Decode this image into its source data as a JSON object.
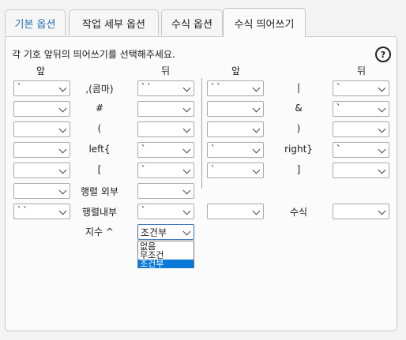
{
  "tabs": [
    {
      "label": "기본 옵션"
    },
    {
      "label": "작업 세부 옵션"
    },
    {
      "label": "수식 옵션"
    },
    {
      "label": "수식 띄어쓰기"
    }
  ],
  "instruction": "각 기호 앞뒤의 띄어쓰기를 선택해주세요.",
  "help_icon": "?",
  "headers": {
    "left_before": "앞",
    "left_after": "뒤",
    "right_before": "앞",
    "right_after": "뒤"
  },
  "rows": [
    {
      "label": ",(콤마)",
      "before": "`",
      "after": "``",
      "r_label": "|",
      "r_before": "``",
      "r_after": "`"
    },
    {
      "label": "#",
      "before": "",
      "after": "",
      "r_label": "&",
      "r_before": "",
      "r_after": "`"
    },
    {
      "label": "(",
      "before": "",
      "after": "",
      "r_label": ")",
      "r_before": "",
      "r_after": ""
    },
    {
      "label": "left{",
      "before": "",
      "after": "`",
      "r_label": "right}",
      "r_before": "`",
      "r_after": "`"
    },
    {
      "label": "[",
      "before": "",
      "after": "`",
      "r_label": "]",
      "r_before": "`",
      "r_after": ""
    },
    {
      "label": "행렬 외부",
      "before": "",
      "after": ""
    },
    {
      "label": "행렬내부",
      "before": "``",
      "after": "`",
      "r_label": "수식",
      "r_before": "",
      "r_after": ""
    }
  ],
  "exponent": {
    "label": "지수 ^",
    "value": "조건부",
    "options": [
      "없음",
      "무조건",
      "조건부"
    ],
    "selected_index": 2
  }
}
